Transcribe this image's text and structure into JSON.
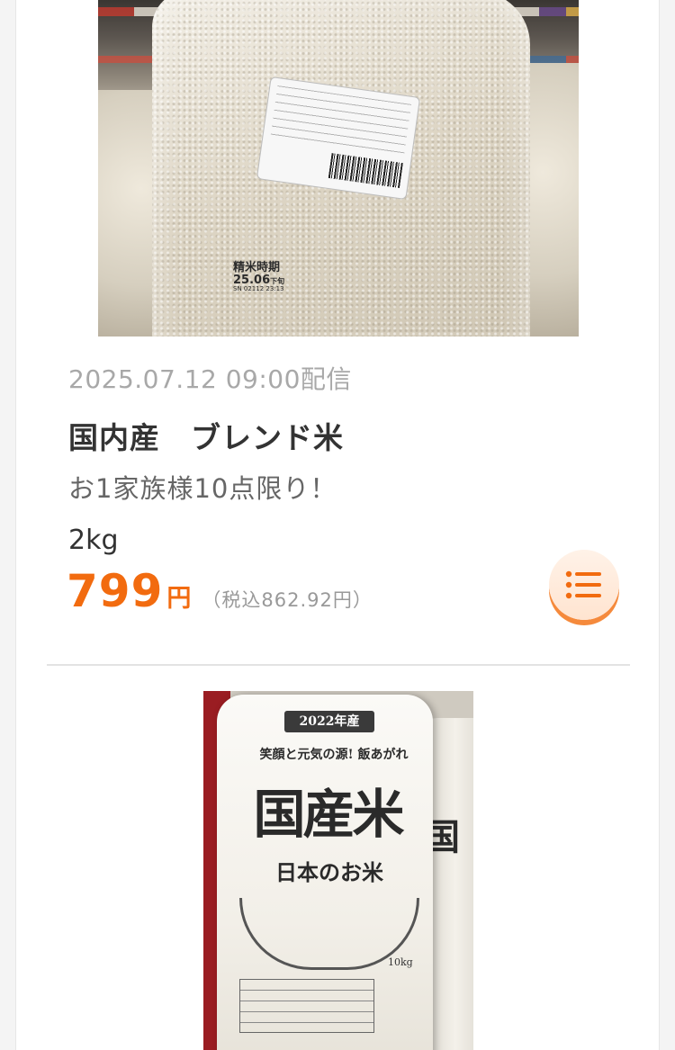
{
  "items": [
    {
      "photo": {
        "mill_label": "精米時期",
        "mill_date": "25.06",
        "mill_date_suffix": "下旬",
        "mill_code": "SN  02112 23:13"
      },
      "published": "2025.07.12 09:00配信",
      "title": "国内産　ブレンド米",
      "note": "お1家族様10点限り！",
      "quantity": "2kg",
      "price": "799",
      "price_unit": "円",
      "price_tax": "（税込862.92円）",
      "list_icon": "list-icon"
    },
    {
      "photo": {
        "year_badge": "2022年産",
        "catchphrase": "笑顔と元気の源! 飯あがれ",
        "big_text": "国産米",
        "sub_text": "日本のお米",
        "weight": "10kg",
        "back_text": "国"
      }
    }
  ],
  "colors": {
    "accent": "#f26b0f",
    "date": "#a8a8a8",
    "title": "#333333"
  }
}
